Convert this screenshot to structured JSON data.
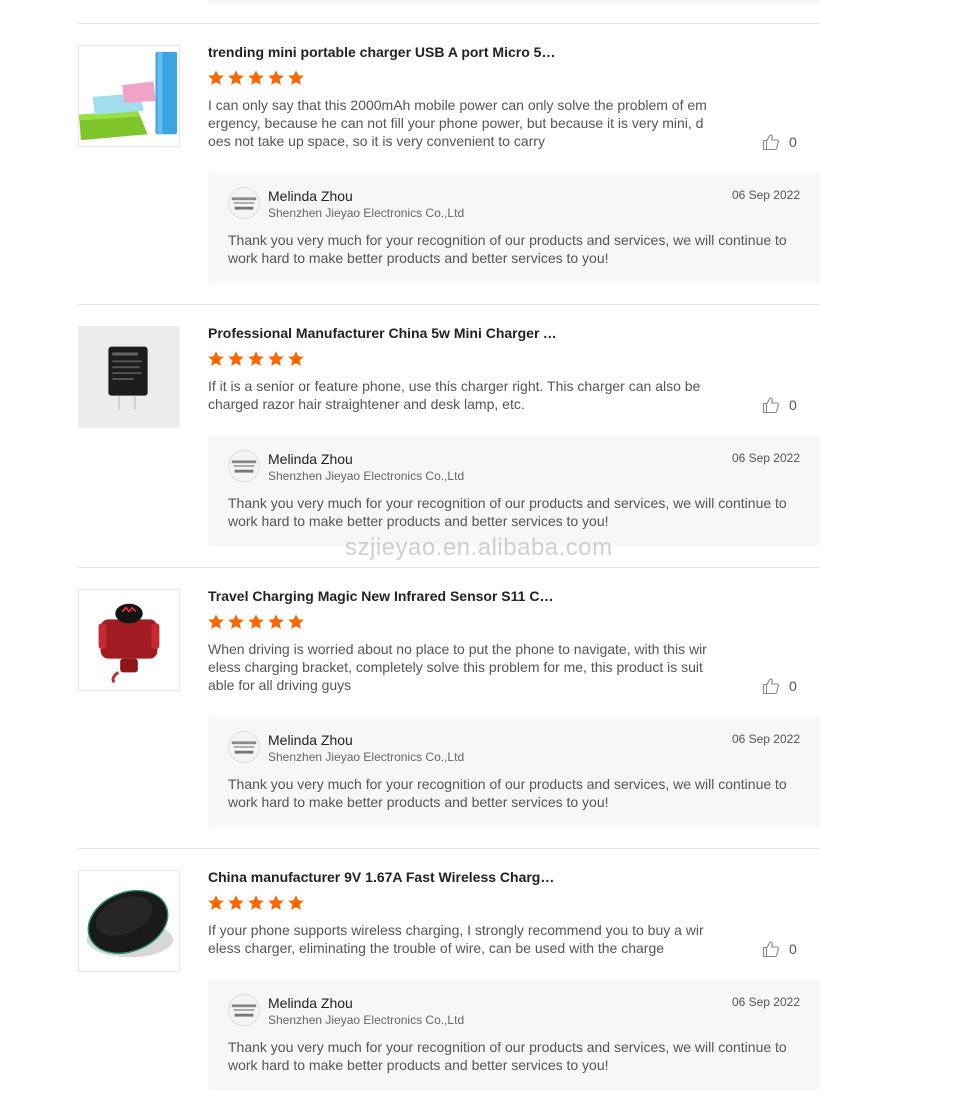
{
  "watermark": "szjieyao.en.alibaba.com",
  "colors": {
    "star": "#ff6600",
    "reply_bg": "#f6f7f9",
    "divider": "#e4e4e4"
  },
  "reviews": [
    {
      "product_title": "trending mini portable charger USB A port Micro 5pi...",
      "rating": 5,
      "text": "I can only say that this 2000mAh mobile power can only solve the problem of emergency, because he can not fill your phone power, but because it is very mini, does not take up space, so it is very convenient to carry",
      "helpful_count": "0",
      "thumbnail": "power-bank-image",
      "reply": {
        "name": "Melinda Zhou",
        "company": "Shenzhen Jieyao Electronics Co.,Ltd",
        "date": "06 Sep 2022",
        "text": "Thank you very much for your recognition of our products and services, we will continue to work hard to make better products and better services to you!"
      }
    },
    {
      "product_title": "Professional Manufacturer China 5w Mini Charger A...",
      "rating": 5,
      "text": "If it is a senior or feature phone, use this charger right. This charger can also be charged razor hair straightener and desk lamp, etc.",
      "helpful_count": "0",
      "thumbnail": "wall-charger-image",
      "reply": {
        "name": "Melinda Zhou",
        "company": "Shenzhen Jieyao Electronics Co.,Ltd",
        "date": "06 Sep 2022",
        "text": "Thank you very much for your recognition of our products and services, we will continue to work hard to make better products and better services to you!"
      }
    },
    {
      "product_title": "Travel Charging Magic New Infrared Sensor S11 Car ...",
      "rating": 5,
      "text": "When driving is worried about no place to put the phone to navigate, with this wireless charging bracket, completely solve this problem for me, this product is suitable for all driving guys",
      "helpful_count": "0",
      "thumbnail": "car-phone-holder-image",
      "reply": {
        "name": "Melinda Zhou",
        "company": "Shenzhen Jieyao Electronics Co.,Ltd",
        "date": "06 Sep 2022",
        "text": "Thank you very much for your recognition of our products and services, we will continue to work hard to make better products and better services to you!"
      }
    },
    {
      "product_title": "China manufacturer 9V 1.67A Fast Wireless Chargin...",
      "rating": 5,
      "text": "If your phone supports wireless charging, I strongly recommend you to buy a wireless charger, eliminating the trouble of wire, can be used with the charge",
      "helpful_count": "0",
      "thumbnail": "wireless-charger-pad-image",
      "reply": {
        "name": "Melinda Zhou",
        "company": "Shenzhen Jieyao Electronics Co.,Ltd",
        "date": "06 Sep 2022",
        "text": "Thank you very much for your recognition of our products and services, we will continue to work hard to make better products and better services to you!"
      }
    }
  ]
}
